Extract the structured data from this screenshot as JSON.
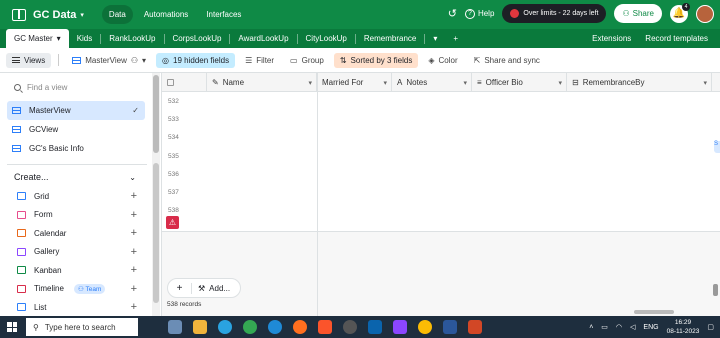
{
  "header": {
    "base_name": "GC Data",
    "nav": [
      "Data",
      "Automations",
      "Interfaces"
    ],
    "help": "Help",
    "limits": "Over limits - 22 days left",
    "share": "Share",
    "notifications": "4"
  },
  "tables": {
    "active": "GC Master",
    "items": [
      "Kids",
      "RankLookUp",
      "CorpsLookUp",
      "AwardLookUp",
      "CityLookUp",
      "Remembrance"
    ],
    "add": "+",
    "extensions": "Extensions",
    "record_templates": "Record templates"
  },
  "toolbar": {
    "views": "Views",
    "current_view": "MasterView",
    "hidden": "19 hidden fields",
    "filter": "Filter",
    "group": "Group",
    "sorted": "Sorted by 3 fields",
    "color": "Color",
    "share_sync": "Share and sync"
  },
  "sidebar": {
    "find_placeholder": "Find a view",
    "views": [
      "MasterView",
      "GCView",
      "GC's Basic Info"
    ],
    "create_label": "Create...",
    "create_items": [
      {
        "label": "Grid",
        "color": "#2d7ff9"
      },
      {
        "label": "Form",
        "color": "#e74c8c"
      },
      {
        "label": "Calendar",
        "color": "#e8681a"
      },
      {
        "label": "Gallery",
        "color": "#8b46ff"
      },
      {
        "label": "Kanban",
        "color": "#0f8a46"
      },
      {
        "label": "Timeline",
        "color": "#d82c4a"
      },
      {
        "label": "List",
        "color": "#2d7ff9"
      }
    ],
    "team_badge": "Team"
  },
  "grid": {
    "columns": [
      "Name",
      "Married For",
      "Notes",
      "Officer Bio",
      "RemembranceBy"
    ],
    "row_numbers": [
      "532",
      "533",
      "534",
      "535",
      "536",
      "537",
      "538"
    ],
    "add_label": "Add...",
    "records": "538 records",
    "side_chip": "S"
  },
  "taskbar": {
    "search": "Type here to search",
    "lang": "ENG",
    "time": "16:29",
    "date": "08-11-2023"
  },
  "colors": {
    "brand": "#0f8a46",
    "tab_bar": "#0a7a3c",
    "hidden_fields": "#c4ecff",
    "sorted": "#ffe0cc",
    "active_view": "#d7e8ff"
  }
}
